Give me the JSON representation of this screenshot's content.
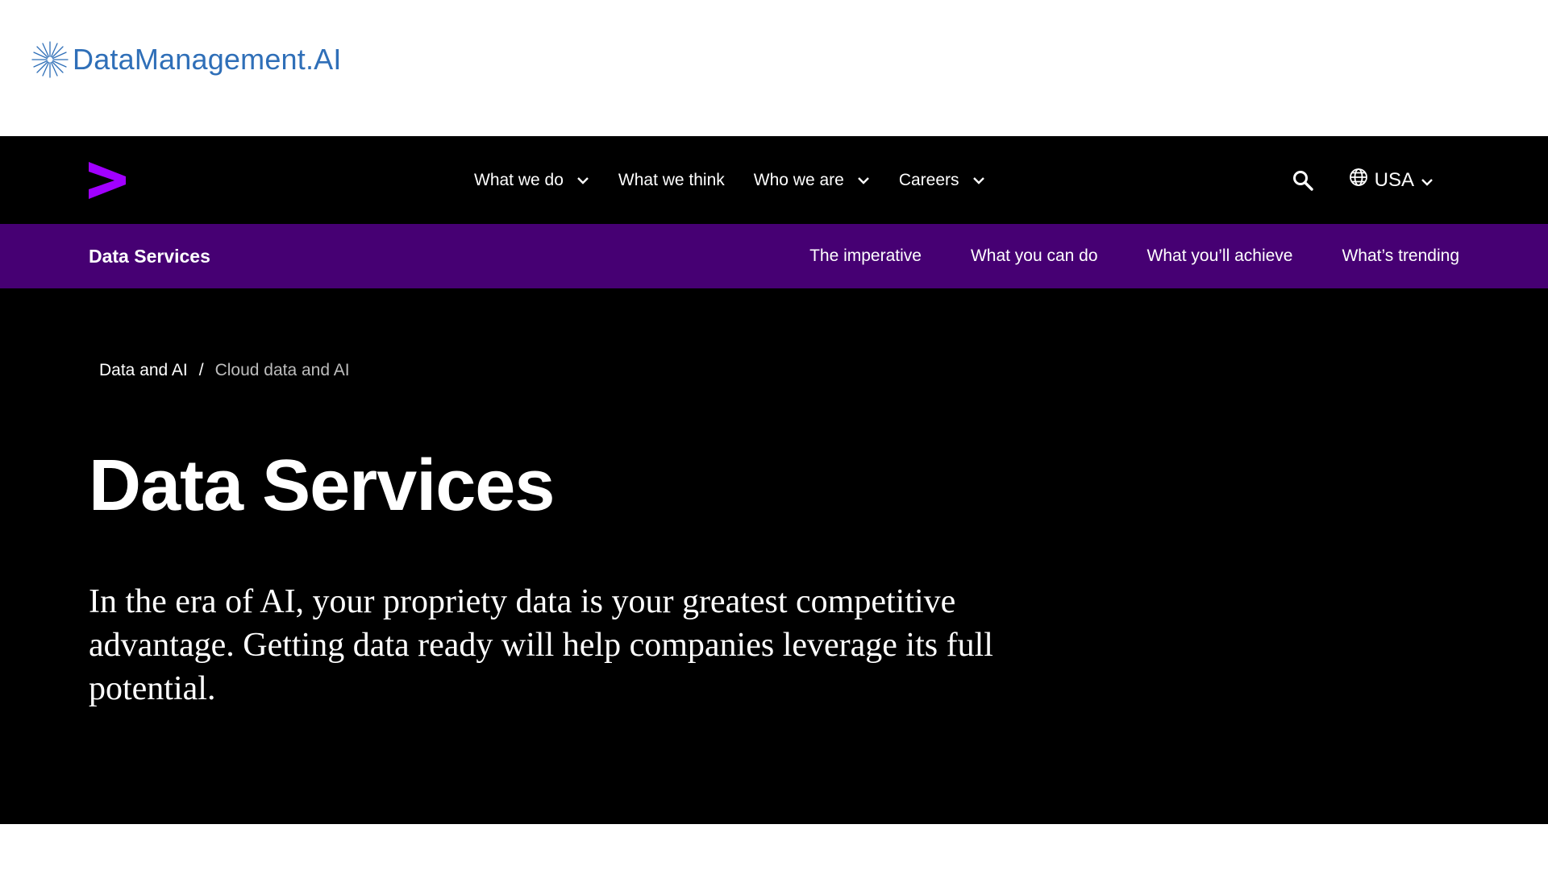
{
  "banner": {
    "brand_name": "DataManagement.AI",
    "brand_color": "#2f6fb8",
    "logo_icon": "starburst-icon"
  },
  "global_nav": {
    "logo_icon": "chevron-greater-than-logo-icon",
    "accent_color": "#a100ff",
    "items": [
      {
        "label": "What we do",
        "has_dropdown": true
      },
      {
        "label": "What we think",
        "has_dropdown": false
      },
      {
        "label": "Who we are",
        "has_dropdown": true
      },
      {
        "label": "Careers",
        "has_dropdown": true
      }
    ],
    "search_icon": "search-icon",
    "locale": {
      "icon": "globe-icon",
      "label": "USA"
    }
  },
  "sub_nav": {
    "title": "Data Services",
    "background": "#460073",
    "links": [
      {
        "label": "The imperative"
      },
      {
        "label": "What you can do"
      },
      {
        "label": "What you’ll achieve"
      },
      {
        "label": "What’s trending"
      }
    ]
  },
  "hero": {
    "breadcrumb": {
      "parent": "Data and AI",
      "separator": "/",
      "current": "Cloud data and AI"
    },
    "title": "Data Services",
    "description": "In the era of AI, your propriety data is your greatest competitive advantage. Getting data ready will help companies leverage its full potential."
  }
}
